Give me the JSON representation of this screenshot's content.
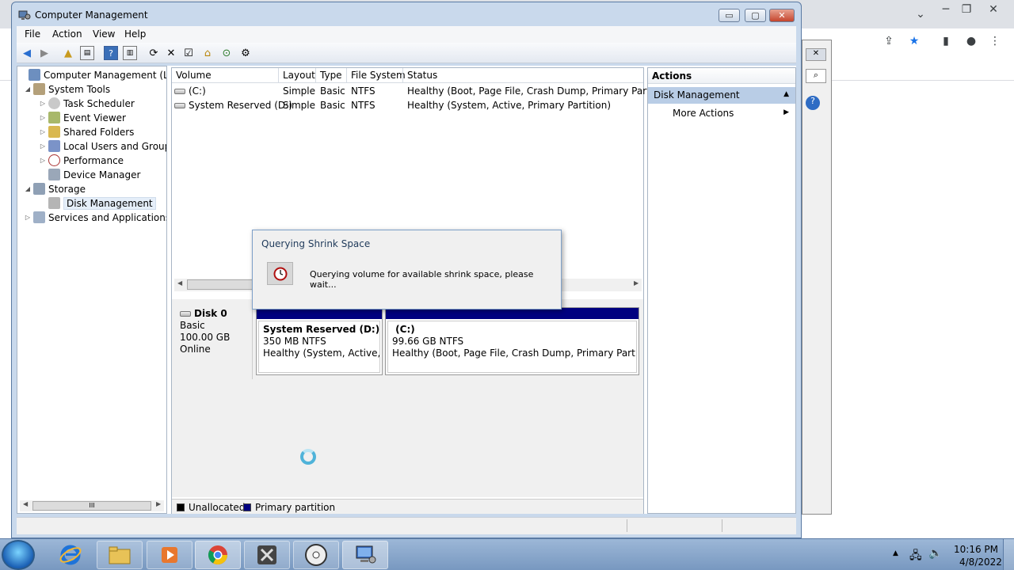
{
  "window": {
    "title": "Computer Management",
    "controls": {
      "minimize": "▭",
      "maximize": "▢",
      "close": "✕"
    }
  },
  "menu": [
    "File",
    "Action",
    "View",
    "Help"
  ],
  "tree": {
    "root": "Computer Management (Local",
    "system_tools": "System Tools",
    "task_scheduler": "Task Scheduler",
    "event_viewer": "Event Viewer",
    "shared_folders": "Shared Folders",
    "local_users": "Local Users and Groups",
    "performance": "Performance",
    "device_manager": "Device Manager",
    "storage": "Storage",
    "disk_management": "Disk Management",
    "services": "Services and Applications"
  },
  "volumes": {
    "headers": [
      "Volume",
      "Layout",
      "Type",
      "File System",
      "Status"
    ],
    "rows": [
      {
        "volume": "(C:)",
        "layout": "Simple",
        "type": "Basic",
        "fs": "NTFS",
        "status": "Healthy (Boot, Page File, Crash Dump, Primary Partition)"
      },
      {
        "volume": "System Reserved (D:)",
        "layout": "Simple",
        "type": "Basic",
        "fs": "NTFS",
        "status": "Healthy (System, Active, Primary Partition)"
      }
    ]
  },
  "disk": {
    "name": "Disk 0",
    "type": "Basic",
    "size": "100.00 GB",
    "state": "Online",
    "partitions": [
      {
        "name": "System Reserved  (D:)",
        "size": "350 MB NTFS",
        "status": "Healthy (System, Active, Primary Partition)"
      },
      {
        "name": " (C:)",
        "size": "99.66 GB NTFS",
        "status": "Healthy (Boot, Page File, Crash Dump, Primary Partition)"
      }
    ]
  },
  "legend": {
    "unallocated": "Unallocated",
    "primary": "Primary partition",
    "colors": {
      "unallocated": "#000000",
      "primary": "#000080"
    }
  },
  "actions": {
    "header": "Actions",
    "section": "Disk Management",
    "more": "More Actions"
  },
  "dialog": {
    "title": "Querying Shrink Space",
    "message": "Querying volume for available shrink space, please wait..."
  },
  "scroll": {
    "grip": "III"
  },
  "taskbar": {
    "items": [
      "internet-explorer",
      "file-explorer",
      "media-player",
      "chrome",
      "tools",
      "my-hbcd",
      "computer-management"
    ],
    "time": "10:16 PM",
    "date": "4/8/2022"
  }
}
